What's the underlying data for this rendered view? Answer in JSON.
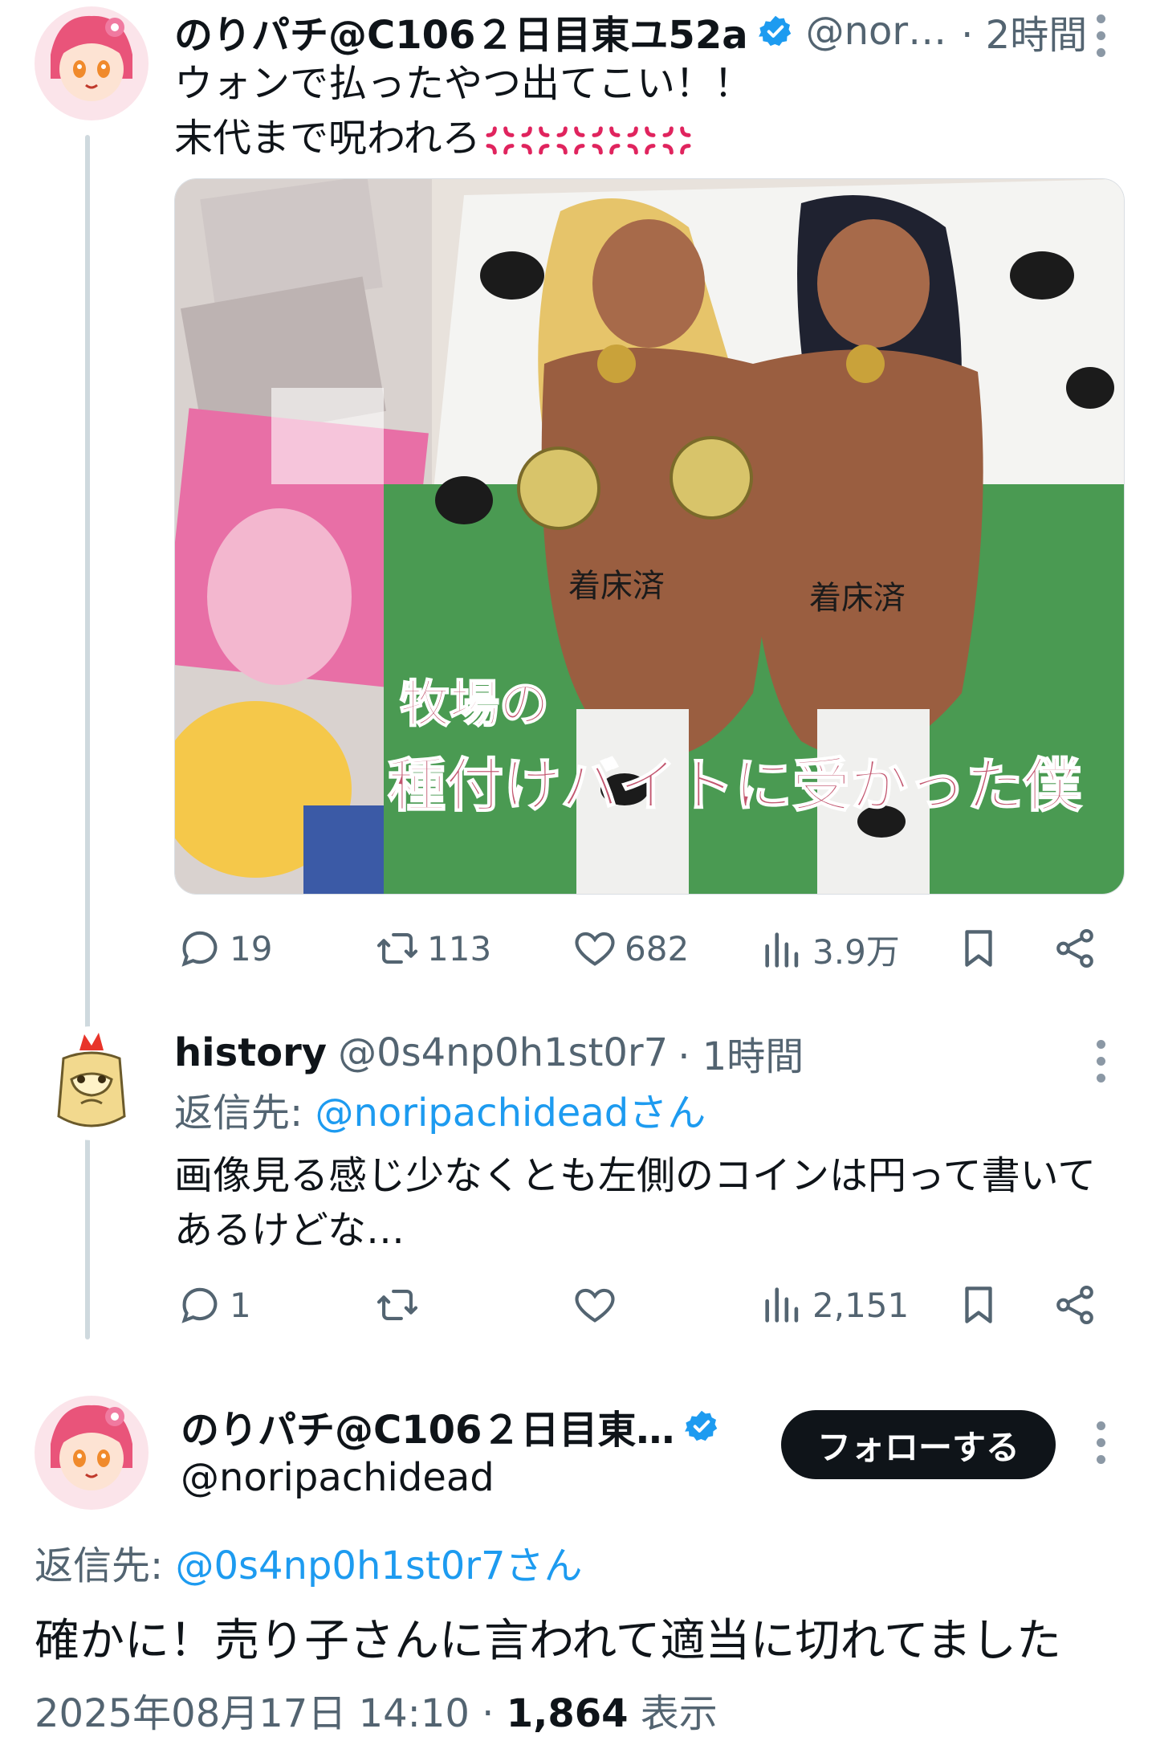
{
  "tweet1": {
    "display_name": "のりパチ@C106２日目東ユ52a",
    "handle": "@nor…",
    "time": "· 2時間",
    "text_line1": "ウォンで払ったやつ出てこい！！",
    "text_line2": "末代まで呪われろ",
    "anger_emoji_count": 6,
    "image_title_line1": "牧場の",
    "image_title_line2": "種付けバイトに受かった僕",
    "image_body_text": "着床済",
    "actions": {
      "reply": "19",
      "retweet": "113",
      "like": "682",
      "views": "3.9万"
    }
  },
  "tweet2": {
    "display_name": "history",
    "handle": "@0s4np0h1st0r7",
    "time": "· 1時間",
    "reply_prefix": "返信先: ",
    "reply_to": "@noripachideadさん",
    "text_line1": "画像見る感じ少なくとも左側のコインは円って書いて",
    "text_line2": "あるけどな…",
    "actions": {
      "reply": "1",
      "retweet": "",
      "like": "",
      "views": "2,151"
    }
  },
  "tweet3": {
    "display_name": "のりパチ@C106２日目東…",
    "handle": "@noripachidead",
    "follow_label": "フォローする",
    "reply_prefix": "返信先: ",
    "reply_to": "@0s4np0h1st0r7さん",
    "text": "確かに！売り子さんに言われて適当に切れてました",
    "timestamp": "2025年08月17日 14:10",
    "separator": " · ",
    "view_count": "1,864",
    "view_label": " 表示"
  },
  "icons": {
    "reply": "speech-bubble-icon",
    "retweet": "repost-arrows-icon",
    "like": "heart-icon",
    "views": "bar-chart-icon",
    "bookmark": "bookmark-icon",
    "share": "share-icon",
    "more": "vertical-dots-icon",
    "verified": "verified-badge-icon",
    "anger": "anger-symbol-emoji"
  },
  "colors": {
    "text": "#0f1419",
    "muted": "#536471",
    "link": "#1d9bf0",
    "verified": "#1d9bf0",
    "thread_line": "#cfd9de",
    "follow_button": "#0f1419"
  }
}
